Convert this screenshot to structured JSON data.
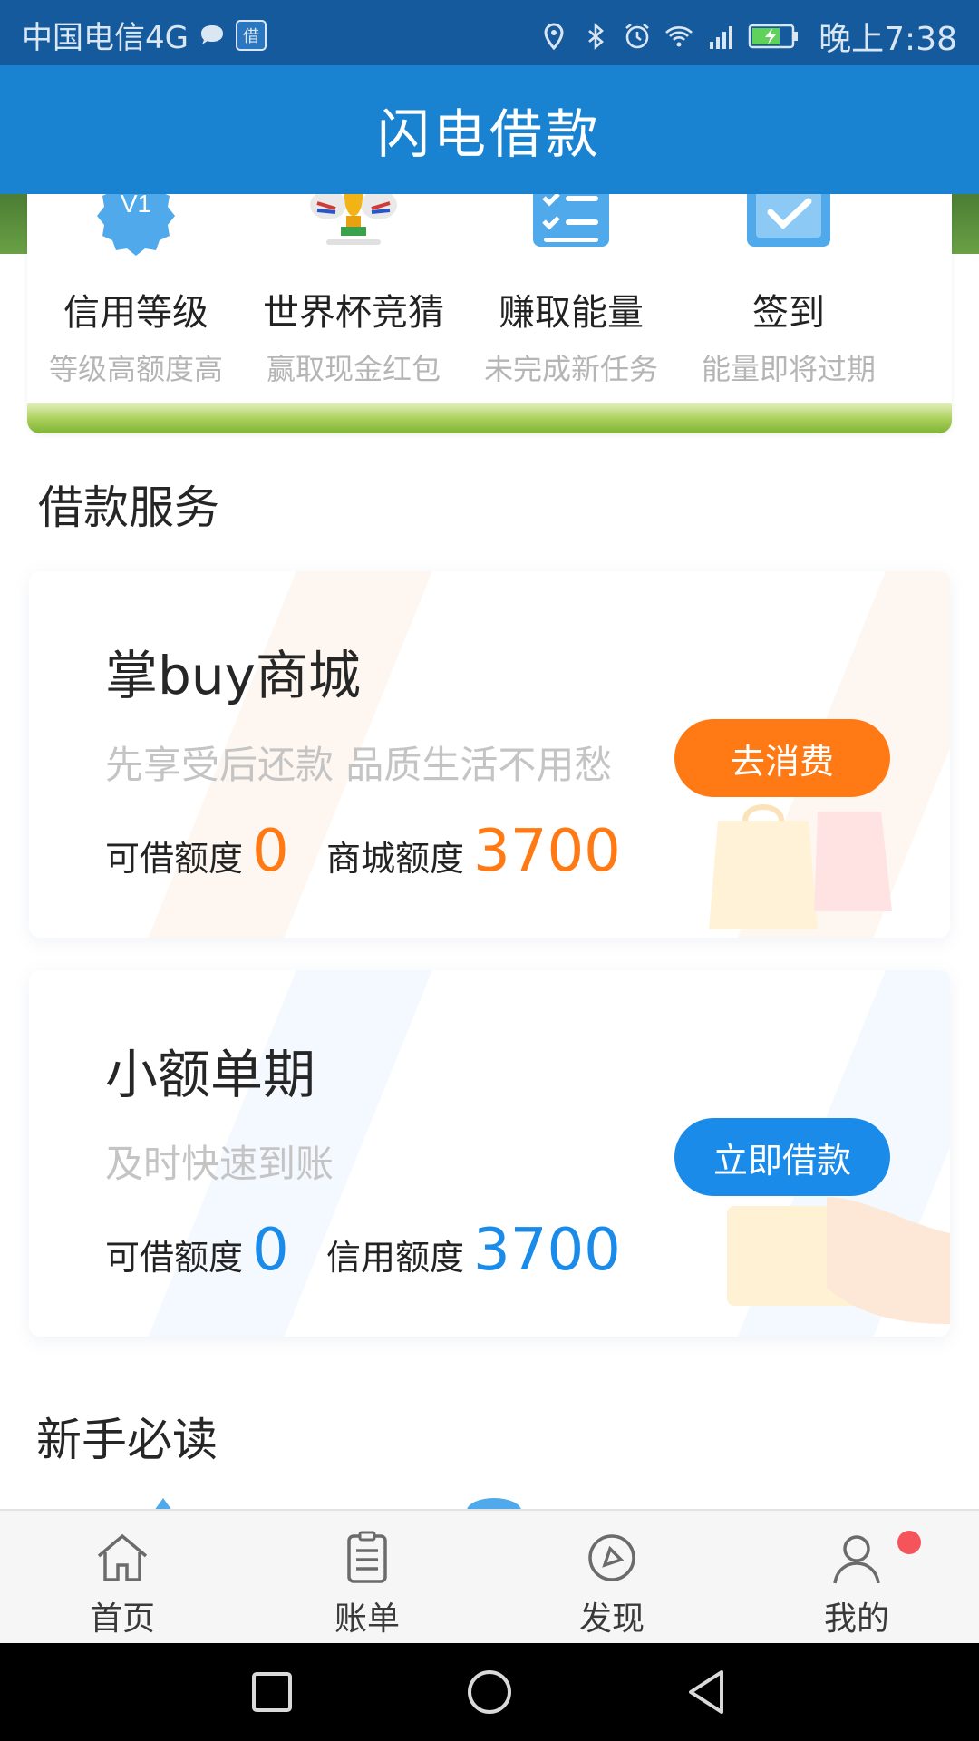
{
  "status_bar": {
    "carrier": "中国电信4G",
    "app_badge": "借",
    "time": "晚上7:38",
    "icons": [
      "message-bubble-icon",
      "location-icon",
      "bluetooth-icon",
      "alarm-icon",
      "wifi-icon",
      "signal-4g-icon",
      "battery-charging-icon"
    ]
  },
  "header": {
    "title": "闪电借款"
  },
  "activities": [
    {
      "title": "信用等级",
      "subtitle": "等级高额度高",
      "icon": "vip-badge-icon",
      "badge_text": "V1"
    },
    {
      "title": "世界杯竞猜",
      "subtitle": "赢取现金红包",
      "icon": "trophy-icon"
    },
    {
      "title": "赚取能量",
      "subtitle": "未完成新任务",
      "icon": "checklist-icon"
    },
    {
      "title": "签到",
      "subtitle": "能量即将过期",
      "icon": "checkin-icon"
    }
  ],
  "loan_services": {
    "section_title": "借款服务",
    "cards": [
      {
        "title": "掌buy商城",
        "subtitle": "先享受后还款 品质生活不用愁",
        "button": "去消费",
        "quota_label_1": "可借额度",
        "quota_value_1": "0",
        "quota_label_2": "商城额度",
        "quota_value_2": "3700",
        "accent_color": "#ff7a14"
      },
      {
        "title": "小额单期",
        "subtitle": "及时快速到账",
        "button": "立即借款",
        "quota_label_1": "可借额度",
        "quota_value_1": "0",
        "quota_label_2": "信用额度",
        "quota_value_2": "3700",
        "accent_color": "#1a8be8"
      }
    ]
  },
  "newbie": {
    "section_title": "新手必读"
  },
  "bottom_nav": [
    {
      "label": "首页",
      "icon": "home-icon"
    },
    {
      "label": "账单",
      "icon": "bill-icon"
    },
    {
      "label": "发现",
      "icon": "compass-icon"
    },
    {
      "label": "我的",
      "icon": "profile-icon",
      "has_notification_dot": true
    }
  ],
  "system_nav": [
    "recents-button",
    "home-button",
    "back-button"
  ]
}
